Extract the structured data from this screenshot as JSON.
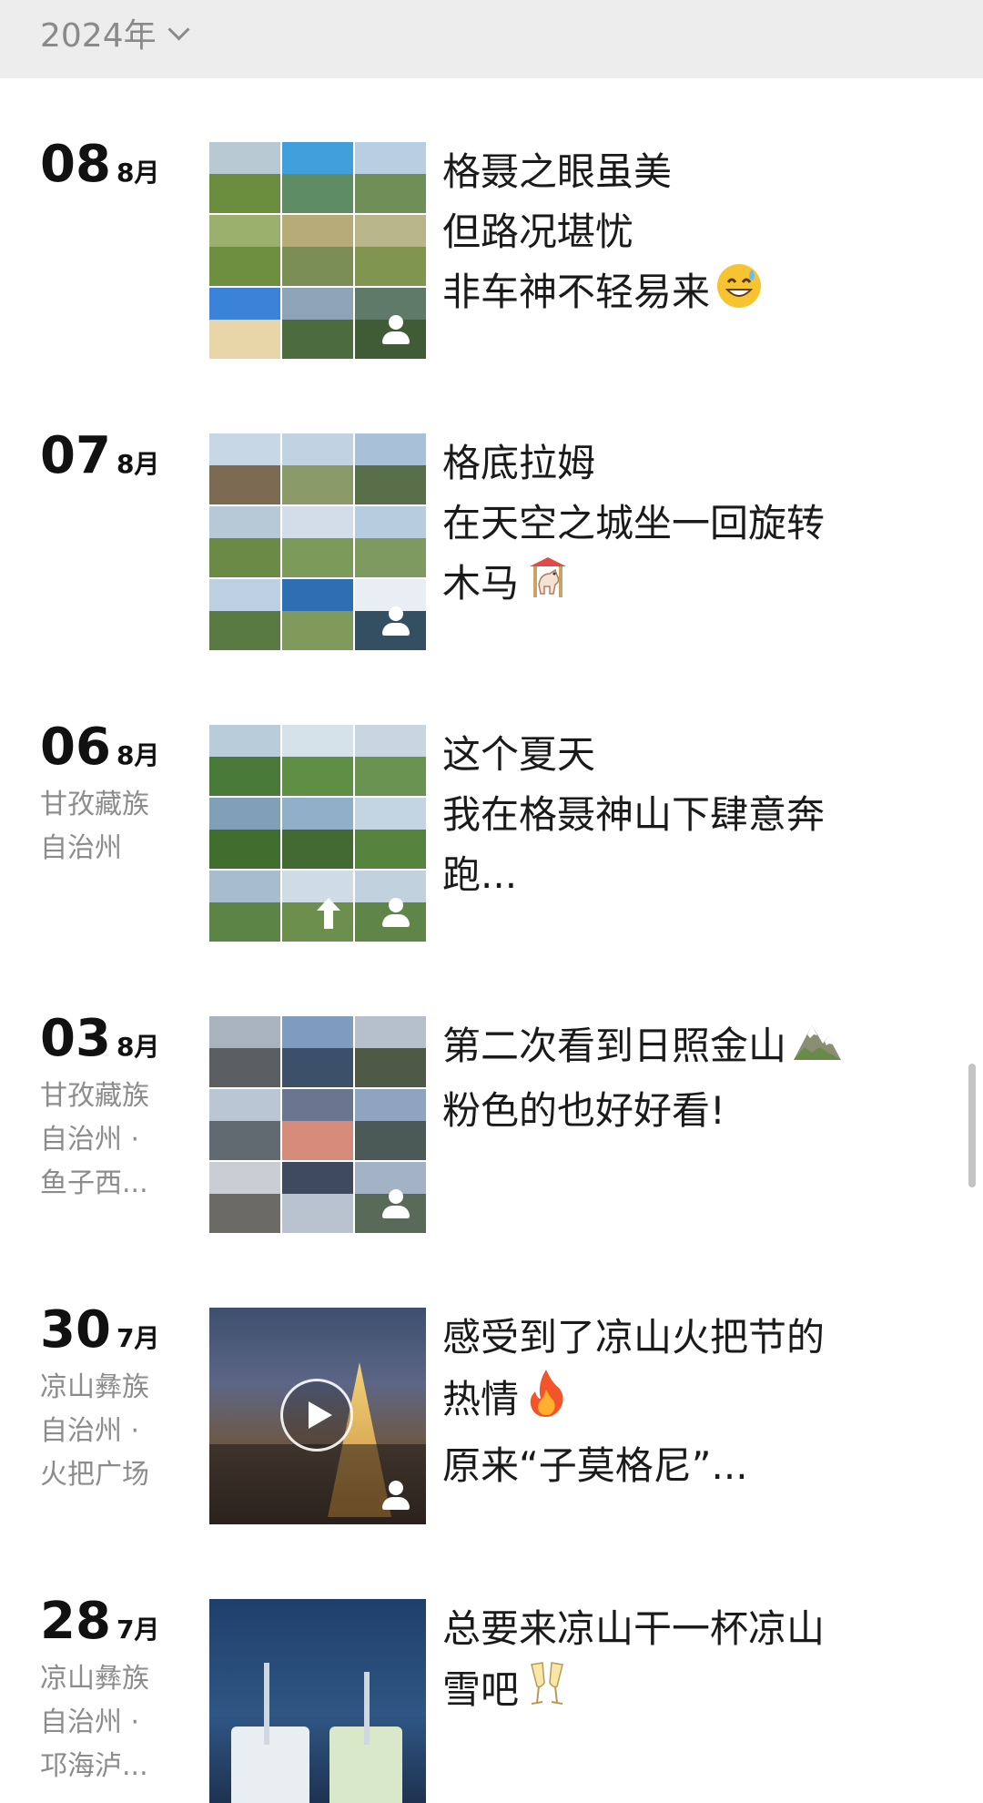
{
  "header": {
    "year_label": "2024年"
  },
  "posts": [
    {
      "day": "08",
      "month": "8月",
      "location": [],
      "lines": [
        "格聂之眼虽美",
        "但路况堪忧",
        "非车神不轻易来"
      ],
      "emoji_icon": "sweat-smile-emoji",
      "media": "photo-grid"
    },
    {
      "day": "07",
      "month": "8月",
      "location": [],
      "lines": [
        "格底拉姆",
        "在天空之城坐一回旋转",
        "木马"
      ],
      "emoji_icon": "carousel-horse-emoji",
      "media": "photo-grid"
    },
    {
      "day": "06",
      "month": "8月",
      "location": [
        "甘孜藏族",
        "自治州"
      ],
      "lines": [
        "这个夏天",
        "我在格聂神山下肆意奔",
        "跑..."
      ],
      "emoji_icon": "",
      "media": "photo-grid"
    },
    {
      "day": "03",
      "month": "8月",
      "location": [
        "甘孜藏族",
        "自治州 ·",
        "鱼子西..."
      ],
      "lines": [
        "第二次看到日照金山",
        "粉色的也好好看!"
      ],
      "emoji_icon": "snow-mountain-emoji",
      "media": "photo-grid"
    },
    {
      "day": "30",
      "month": "7月",
      "location": [
        "凉山彝族",
        "自治州 ·",
        "火把广场"
      ],
      "lines": [
        "感受到了凉山火把节的",
        "热情",
        "原来“子莫格尼”..."
      ],
      "emoji_icon": "fire-emoji",
      "media": "video"
    },
    {
      "day": "28",
      "month": "7月",
      "location": [
        "凉山彝族",
        "自治州 ·",
        "邛海泸..."
      ],
      "lines": [
        "总要来凉山干一杯凉山",
        "雪吧"
      ],
      "emoji_icon": "clinking-glasses-emoji",
      "media": "photo"
    }
  ],
  "colors": {
    "header_bg": "#ededed",
    "muted_text": "#8c8c8c",
    "main_text": "#1a1a1a"
  }
}
